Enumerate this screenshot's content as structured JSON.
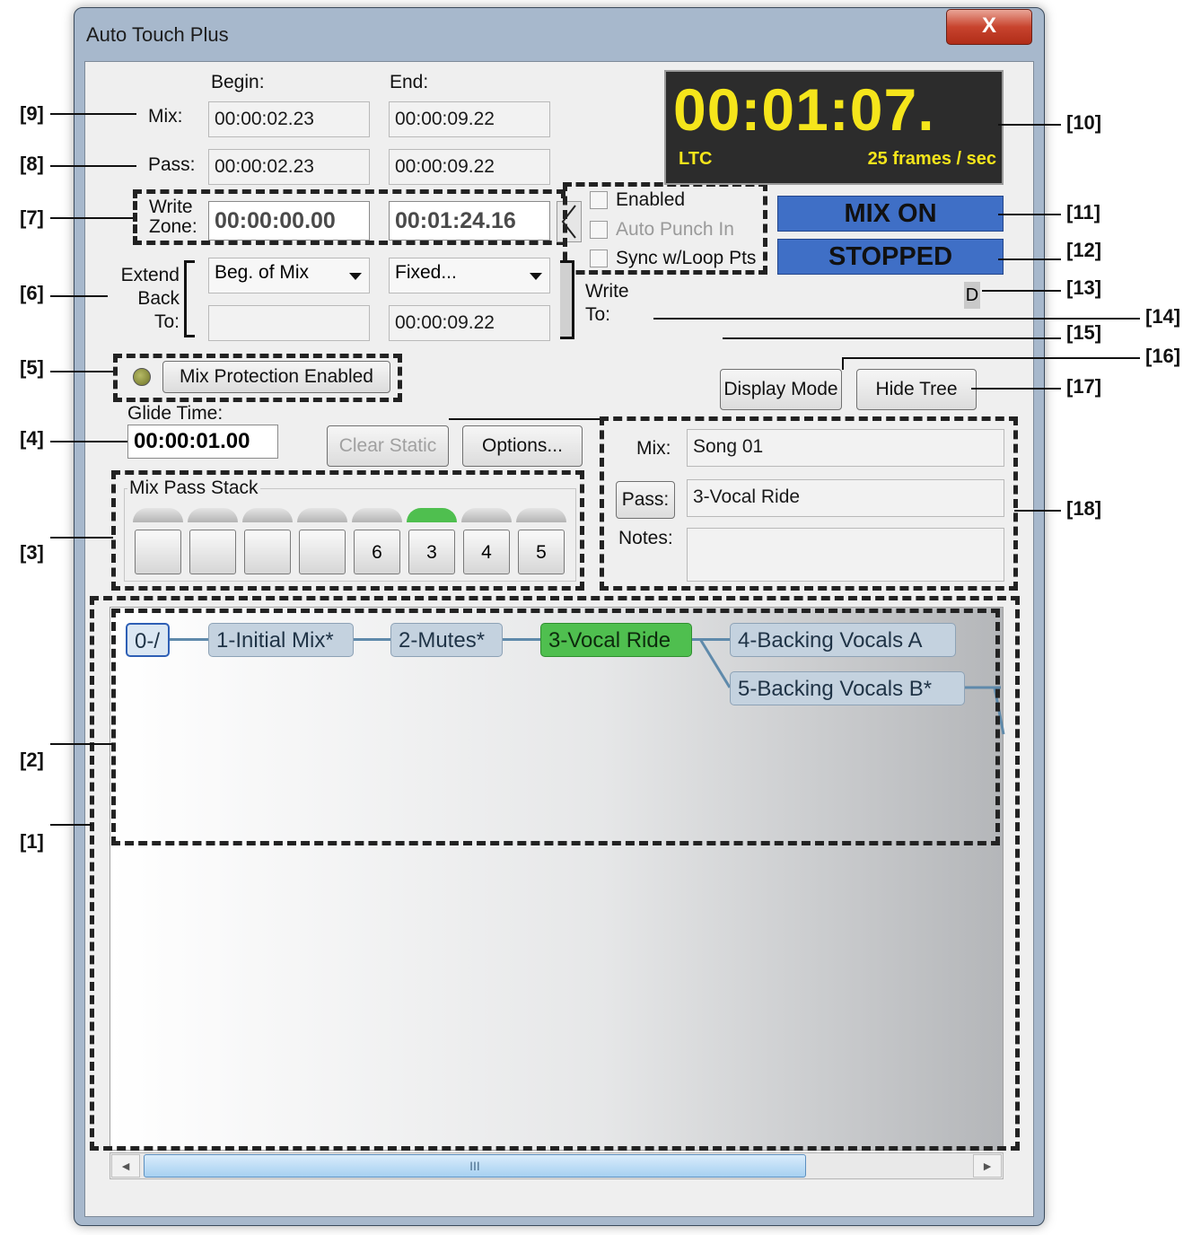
{
  "window": {
    "title": "Auto Touch Plus",
    "close_glyph": "X"
  },
  "times": {
    "begin_label": "Begin:",
    "end_label": "End:",
    "mix_label": "Mix:",
    "pass_label": "Pass:",
    "mix_begin": "00:00:02.23",
    "mix_end": "00:00:09.22",
    "pass_begin": "00:00:02.23",
    "pass_end": "00:00:09.22"
  },
  "write_zone": {
    "label_line1": "Write",
    "label_line2": "Zone:",
    "begin": "00:00:00.00",
    "end": "00:01:24.16",
    "enabled_label": "Enabled",
    "enabled_checked": false,
    "auto_punch_label": "Auto Punch In",
    "auto_punch_checked": false,
    "sync_loop_label": "Sync w/Loop Pts",
    "sync_loop_checked": false
  },
  "extend": {
    "label_line1": "Extend",
    "label_line2": "Back",
    "label_line3": "To:",
    "begin_option": "Beg. of Mix",
    "end_option": "Fixed...",
    "end_value": "00:00:09.22",
    "write_to_line1": "Write",
    "write_to_line2": "To:"
  },
  "timecode": {
    "value": "00:01:07.",
    "source": "LTC",
    "rate": "25 frames / sec",
    "color": "#f5e51b"
  },
  "status": {
    "mix": "MIX ON",
    "transport": "STOPPED",
    "indicator": "D",
    "banner_color": "#3f6fc6"
  },
  "protection": {
    "button_label": "Mix Protection Enabled",
    "led_color": "#8a8f3a"
  },
  "buttons": {
    "display_mode": "Display Mode",
    "hide_tree": "Hide Tree",
    "clear_static": "Clear Static",
    "options": "Options...",
    "pass": "Pass:"
  },
  "glide": {
    "label": "Glide Time:",
    "value": "00:00:01.00"
  },
  "stack": {
    "title": "Mix Pass Stack",
    "slots": [
      "",
      "",
      "",
      "",
      "6",
      "3",
      "4",
      "5"
    ],
    "active_index": 5,
    "active_color": "#4fbf4f"
  },
  "info": {
    "mix_label": "Mix:",
    "mix_value": "Song 01",
    "pass_value": "3-Vocal Ride",
    "notes_label": "Notes:",
    "notes_value": ""
  },
  "tree": {
    "nodes": [
      "0-/",
      "1-Initial Mix*",
      "2-Mutes*",
      "3-Vocal Ride",
      "4-Backing Vocals A",
      "5-Backing Vocals B*"
    ],
    "active_node": "3-Vocal Ride",
    "scroll_glyph": "III"
  },
  "annotations": [
    "[1]",
    "[2]",
    "[3]",
    "[4]",
    "[5]",
    "[6]",
    "[7]",
    "[8]",
    "[9]",
    "[10]",
    "[11]",
    "[12]",
    "[13]",
    "[14]",
    "[15]",
    "[16]",
    "[17]",
    "[18]"
  ]
}
